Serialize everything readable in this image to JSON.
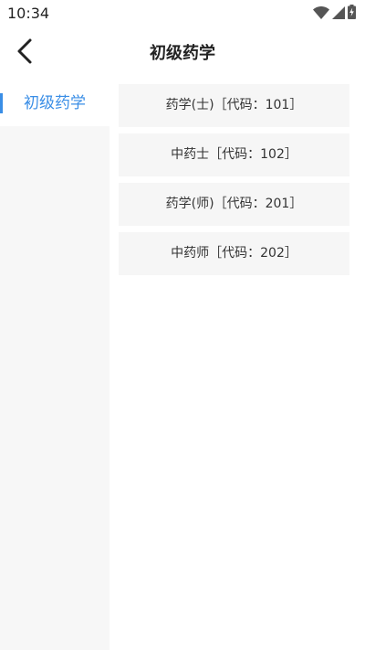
{
  "status_bar": {
    "time": "10:34",
    "icons": [
      "wifi-icon",
      "signal-icon",
      "battery-charging-icon"
    ]
  },
  "header": {
    "back_icon": "chevron-left-icon",
    "title": "初级药学"
  },
  "sidebar": {
    "items": [
      {
        "label": "初级药学",
        "selected": true
      }
    ]
  },
  "courses": [
    {
      "label": "药学(士)［代码：101］"
    },
    {
      "label": "中药士［代码：102］"
    },
    {
      "label": "药学(师)［代码：201］"
    },
    {
      "label": "中药师［代码：202］"
    }
  ],
  "colors": {
    "accent": "#3a8ee6",
    "sidebar_bg": "#f7f7f7",
    "item_bg": "#f6f6f6"
  }
}
